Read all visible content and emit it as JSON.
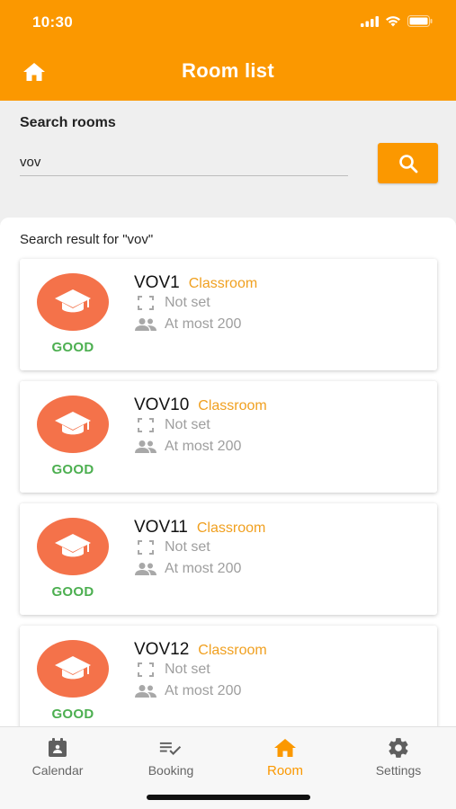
{
  "status_bar": {
    "time": "10:30"
  },
  "header": {
    "title": "Room list",
    "home_icon": "home-icon"
  },
  "search": {
    "label": "Search rooms",
    "value": "vov",
    "placeholder": "",
    "button_icon": "search-icon"
  },
  "results": {
    "label": "Search result for \"vov\"",
    "rooms": [
      {
        "name": "VOV1",
        "type": "Classroom",
        "status": "GOOD",
        "size": "Not set",
        "capacity": "At most 200"
      },
      {
        "name": "VOV10",
        "type": "Classroom",
        "status": "GOOD",
        "size": "Not set",
        "capacity": "At most 200"
      },
      {
        "name": "VOV11",
        "type": "Classroom",
        "status": "GOOD",
        "size": "Not set",
        "capacity": "At most 200"
      },
      {
        "name": "VOV12",
        "type": "Classroom",
        "status": "GOOD",
        "size": "Not set",
        "capacity": "At most 200"
      }
    ]
  },
  "tabs": [
    {
      "label": "Calendar",
      "icon": "calendar-icon",
      "active": false
    },
    {
      "label": "Booking",
      "icon": "booking-icon",
      "active": false
    },
    {
      "label": "Room",
      "icon": "home-icon",
      "active": true
    },
    {
      "label": "Settings",
      "icon": "gear-icon",
      "active": false
    }
  ],
  "colors": {
    "accent": "#FB9800",
    "room_icon_bg": "#F4724A",
    "status_good": "#4CAF50",
    "room_type": "#F0A020"
  }
}
